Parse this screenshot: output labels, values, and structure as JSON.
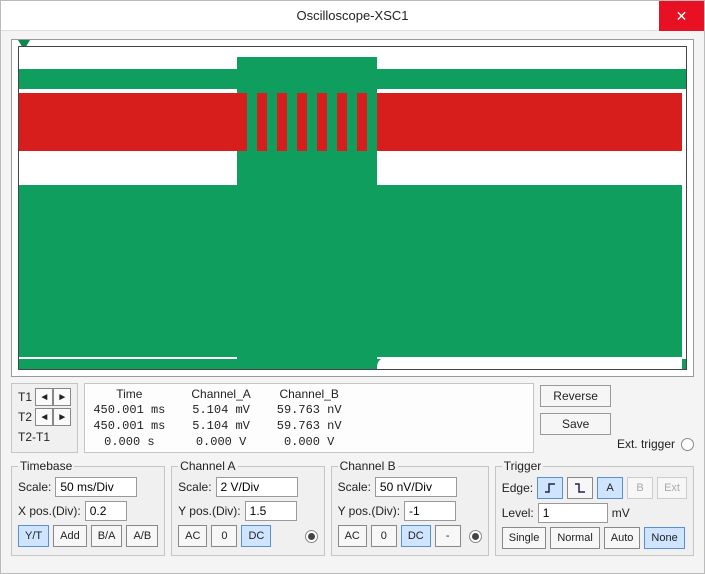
{
  "window": {
    "title": "Oscilloscope-XSC1"
  },
  "cursors": {
    "labels": {
      "t1": "T1",
      "t2": "T2",
      "diff": "T2-T1"
    },
    "headers": {
      "time": "Time",
      "chA": "Channel_A",
      "chB": "Channel_B"
    },
    "t1": {
      "time": "450.001 ms",
      "chA": "5.104 mV",
      "chB": "59.763 nV"
    },
    "t2": {
      "time": "450.001 ms",
      "chA": "5.104 mV",
      "chB": "59.763 nV"
    },
    "diff": {
      "time": "0.000 s",
      "chA": "0.000 V",
      "chB": "0.000 V"
    }
  },
  "buttons": {
    "reverse": "Reverse",
    "save": "Save"
  },
  "ext_trigger_label": "Ext. trigger",
  "timebase": {
    "legend": "Timebase",
    "scale_label": "Scale:",
    "scale": "50 ms/Div",
    "xpos_label": "X pos.(Div):",
    "xpos": "0.2",
    "modes": {
      "yt": "Y/T",
      "add": "Add",
      "ba": "B/A",
      "ab": "A/B"
    }
  },
  "channelA": {
    "legend": "Channel A",
    "scale_label": "Scale:",
    "scale": "2 V/Div",
    "ypos_label": "Y pos.(Div):",
    "ypos": "1.5",
    "coupling": {
      "ac": "AC",
      "zero": "0",
      "dc": "DC"
    }
  },
  "channelB": {
    "legend": "Channel B",
    "scale_label": "Scale:",
    "scale": "50 nV/Div",
    "ypos_label": "Y pos.(Div):",
    "ypos": "-1",
    "coupling": {
      "ac": "AC",
      "zero": "0",
      "dc": "DC",
      "minus": "-"
    }
  },
  "trigger": {
    "legend": "Trigger",
    "edge_label": "Edge:",
    "src": {
      "a": "A",
      "b": "B",
      "ext": "Ext"
    },
    "level_label": "Level:",
    "level": "1",
    "level_unit": "mV",
    "modes": {
      "single": "Single",
      "normal": "Normal",
      "auto": "Auto",
      "none": "None"
    }
  },
  "chart_data": {
    "type": "oscilloscope",
    "timebase_ms_per_div": 50,
    "x_offset_div": 0.2,
    "channels": [
      {
        "name": "A",
        "color": "#d81d1d",
        "scale": "2 V/Div",
        "y_offset_div": 1.5,
        "coupling": "DC"
      },
      {
        "name": "B",
        "color": "#0f9e5e",
        "scale": "50 nV/Div",
        "y_offset_div": -1,
        "coupling": "DC"
      }
    ],
    "cursors": {
      "T1": {
        "time_ms": 450.001,
        "chA_mV": 5.104,
        "chB_nV": 59.763
      },
      "T2": {
        "time_ms": 450.001,
        "chA_mV": 5.104,
        "chB_nV": 59.763
      },
      "delta": {
        "time_s": 0.0,
        "chA_V": 0.0,
        "chB_V": 0.0
      }
    },
    "trigger": {
      "edge": "rising",
      "source": "A",
      "level_mV": 1,
      "mode": "None"
    },
    "note": "Waveforms rendered as dense filled regions; exact sample points not readable from screenshot."
  }
}
